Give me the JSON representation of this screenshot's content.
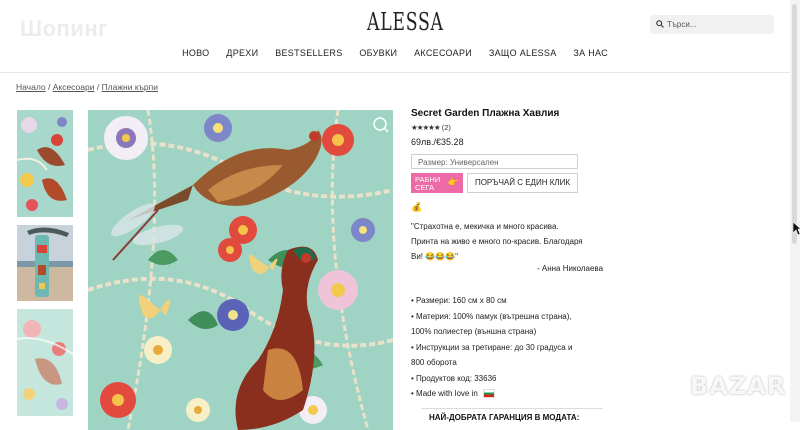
{
  "header": {
    "ghost_title": "Шопинг",
    "logo": "ALESSA",
    "search_placeholder": "Търси...",
    "nav": [
      "НОВО",
      "ДРЕХИ",
      "BESTSELLERS",
      "ОБУВКИ",
      "АКСЕСОАРИ",
      "ЗАЩО ALESSA",
      "ЗА НАС"
    ]
  },
  "breadcrumb": [
    "Начало",
    "Аксесоари",
    "Плажни кърпи"
  ],
  "product": {
    "title": "Secret Garden Плажна Хавлия",
    "stars": "★★★★★",
    "review_count": "(2)",
    "price": "69лв./€35.28",
    "size_placeholder": "Размер: Универсален",
    "add_button_line1": "РАБНИ",
    "add_button_line2": "СЕГА",
    "buy_button": "ПОРЪЧАЙ С ЕДИН КЛИК",
    "money_emoji": "💰",
    "review_lines": [
      "\"Страхотна е, мекичка и много красива.",
      "Принта на живо е много по-красив. Благодаря",
      "Ви! 😂😂😂\""
    ],
    "review_author": "- Анна Николаева",
    "specs": [
      "• Размери: 160 см x 80 см",
      "• Материя: 100% памук (вътрешна страна),",
      "100% полиестер (външна страна)",
      "• Инструкции за третиране: до 30 градуса и",
      "800 оборота",
      "• Продуктов код: 33636",
      "• Made with love in"
    ],
    "guarantee": "НАЙ-ДОБРАТА ГАРАНЦИЯ В МОДАТА:"
  },
  "watermark": "BAZAR",
  "colors": {
    "accent_pink": "#ec6aa6",
    "towel_bg": "#9fd3c4"
  }
}
